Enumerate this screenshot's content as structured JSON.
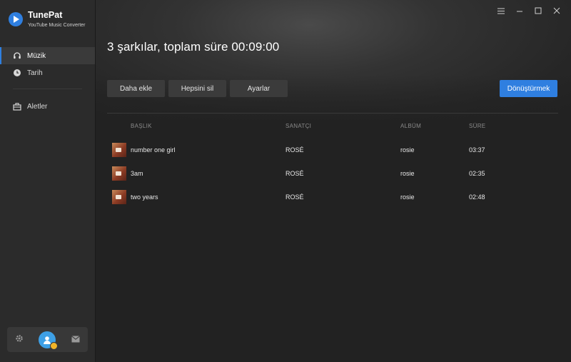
{
  "app": {
    "name": "TunePat",
    "subtitle": "YouTube Music Converter"
  },
  "sidebar": {
    "items": [
      {
        "label": "Müzik",
        "icon": "headphones-icon",
        "active": true
      },
      {
        "label": "Tarih",
        "icon": "clock-icon",
        "active": false
      },
      {
        "label": "Aletler",
        "icon": "toolbox-icon",
        "active": false
      }
    ],
    "bottom": {
      "settings_icon": "gear-icon",
      "avatar_icon": "user-avatar-icon",
      "mail_icon": "mail-icon"
    }
  },
  "window_controls": [
    "menu-icon",
    "minimize-icon",
    "maximize-icon",
    "close-icon"
  ],
  "main": {
    "summary": "3 şarkılar, toplam süre 00:09:00",
    "buttons": {
      "add": "Daha ekle",
      "delete_all": "Hepsini sil",
      "settings": "Ayarlar",
      "convert": "Dönüştürmek"
    },
    "table": {
      "headers": {
        "title": "BAŞLIK",
        "artist": "SANATÇI",
        "album": "ALBÜM",
        "duration": "SÜRE"
      },
      "rows": [
        {
          "title": "number one girl",
          "artist": "ROSÉ",
          "album": "rosie",
          "duration": "03:37"
        },
        {
          "title": "3am",
          "artist": "ROSÉ",
          "album": "rosie",
          "duration": "02:35"
        },
        {
          "title": "two years",
          "artist": "ROSÉ",
          "album": "rosie",
          "duration": "02:48"
        }
      ]
    }
  },
  "colors": {
    "accent": "#2f7fe0",
    "sidebar_bg": "#2b2b2b",
    "main_bg": "#222222",
    "button_bg": "#3b3b3b"
  }
}
